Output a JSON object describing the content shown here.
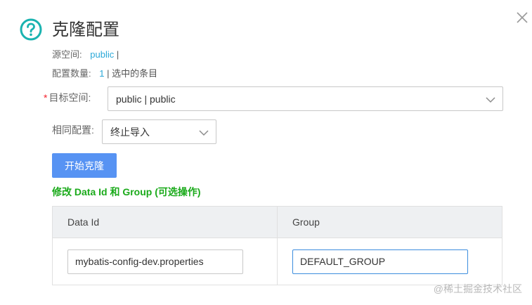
{
  "dialog": {
    "title": "克隆配置",
    "source_namespace_label": "源空间:",
    "source_namespace_value": "public",
    "source_namespace_sep": "|",
    "config_count_label": "配置数量:",
    "config_count_value": "1",
    "config_count_suffix": "| 选中的条目",
    "target_required_mark": "*",
    "target_namespace_label": "目标空间:",
    "target_namespace_value": "public | public",
    "same_config_label": "相同配置:",
    "same_config_value": "终止导入",
    "start_button": "开始克隆",
    "modify_heading": "修改 Data Id 和 Group (可选操作)"
  },
  "table": {
    "headers": [
      "Data Id",
      "Group"
    ],
    "rows": [
      {
        "data_id": "mybatis-config-dev.properties",
        "group": "DEFAULT_GROUP"
      }
    ]
  },
  "watermark": "@稀土掘金技术社区",
  "colors": {
    "primary": "#5793f3",
    "accent_teal": "#1ab3b0",
    "link": "#2aa8d8",
    "heading_green": "#1aaa1a",
    "required": "#f5222d"
  }
}
